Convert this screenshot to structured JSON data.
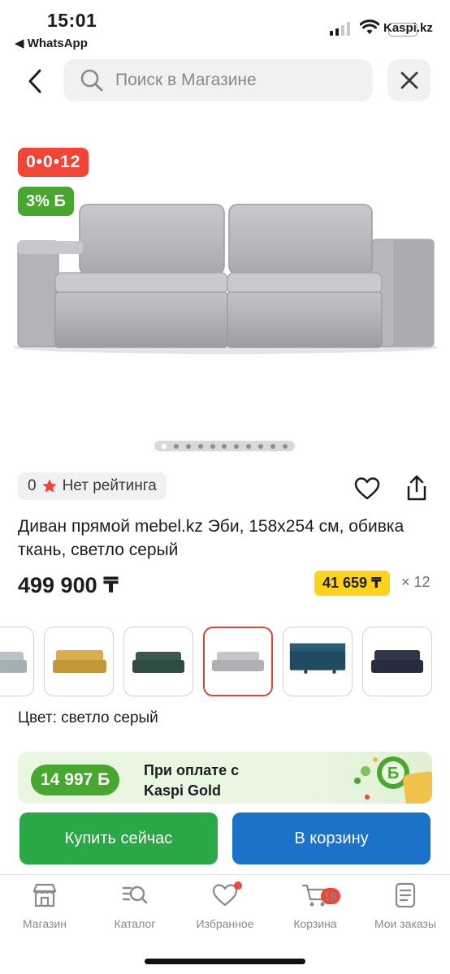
{
  "status_bar": {
    "time": "15:01",
    "back_app": "◀ WhatsApp",
    "carrier": "Kaspi.kz"
  },
  "search": {
    "placeholder": "Поиск в Магазине"
  },
  "icons": {
    "back": "chevron-left-icon",
    "search": "magnifier-icon",
    "close": "close-icon",
    "favorite": "heart-icon",
    "share": "share-icon"
  },
  "product": {
    "badges": {
      "timer": "0•0•12",
      "bonus": "3% Б"
    },
    "rating": {
      "count": "0",
      "label": "Нет рейтинга"
    },
    "title": "Диван прямой mebel.kz Эби, 158х254 см, обивка ткань, светло серый",
    "price": "499 900 ₸",
    "installment": {
      "amount": "41 659 ₸",
      "multiplier": "× 12"
    },
    "color_label": "Цвет: светло серый",
    "gallery": {
      "total": 11,
      "active_index": 0
    },
    "colors": [
      {
        "name": "light-blue",
        "color": "#b9c3c8"
      },
      {
        "name": "mustard",
        "color": "#d2a440"
      },
      {
        "name": "green",
        "color": "#2f4a3f"
      },
      {
        "name": "light-gray",
        "color": "#b9b9bd",
        "selected": true
      },
      {
        "name": "teal",
        "color": "#1f4c63"
      },
      {
        "name": "dark-navy",
        "color": "#272d3e"
      }
    ]
  },
  "kaspi_gold": {
    "amount": "14 997 Б",
    "text_line1": "При оплате с",
    "text_line2": "Kaspi Gold"
  },
  "actions": {
    "buy_now": "Купить сейчас",
    "add_to_cart": "В корзину"
  },
  "colors": {
    "kaspi_red": "#f14635",
    "green": "#2aa847",
    "blue": "#1a73c8",
    "yellow": "#ffd319"
  },
  "tabbar": {
    "items": [
      {
        "label": "Магазин",
        "icon": "shop-icon"
      },
      {
        "label": "Каталог",
        "icon": "catalog-icon"
      },
      {
        "label": "Избранное",
        "icon": "heart-icon"
      },
      {
        "label": "Корзина",
        "icon": "cart-icon",
        "badge": "18"
      },
      {
        "label": "Мои заказы",
        "icon": "orders-icon"
      }
    ]
  }
}
